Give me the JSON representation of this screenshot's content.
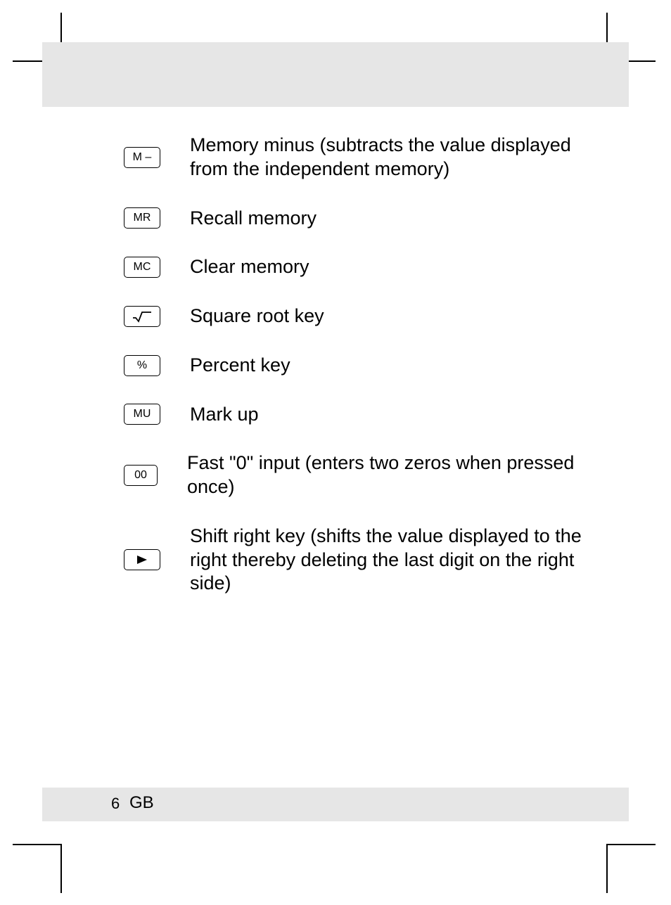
{
  "page": {
    "number": "6",
    "lang": "GB"
  },
  "keys": [
    {
      "icon": "M –",
      "iconType": "text",
      "name": "memory-minus-key",
      "desc": "Memory minus (subtracts the value displayed from the independent memory)"
    },
    {
      "icon": "MR",
      "iconType": "text",
      "name": "memory-recall-key",
      "desc": "Recall memory"
    },
    {
      "icon": "MC",
      "iconType": "text",
      "name": "memory-clear-key",
      "desc": "Clear memory"
    },
    {
      "icon": "sqrt",
      "iconType": "svg",
      "name": "square-root-key",
      "desc": "Square root key"
    },
    {
      "icon": "%",
      "iconType": "text",
      "name": "percent-key",
      "desc": "Percent key"
    },
    {
      "icon": "MU",
      "iconType": "text",
      "name": "mark-up-key",
      "desc": "Mark up"
    },
    {
      "icon": "00",
      "iconType": "text",
      "name": "double-zero-key",
      "desc": "Fast \"0\" input (enters two zeros when pressed once)"
    },
    {
      "icon": "play",
      "iconType": "svg",
      "name": "shift-right-key",
      "desc": "Shift right key (shifts the value displayed to the right thereby deleting the last digit on the right side)"
    }
  ]
}
